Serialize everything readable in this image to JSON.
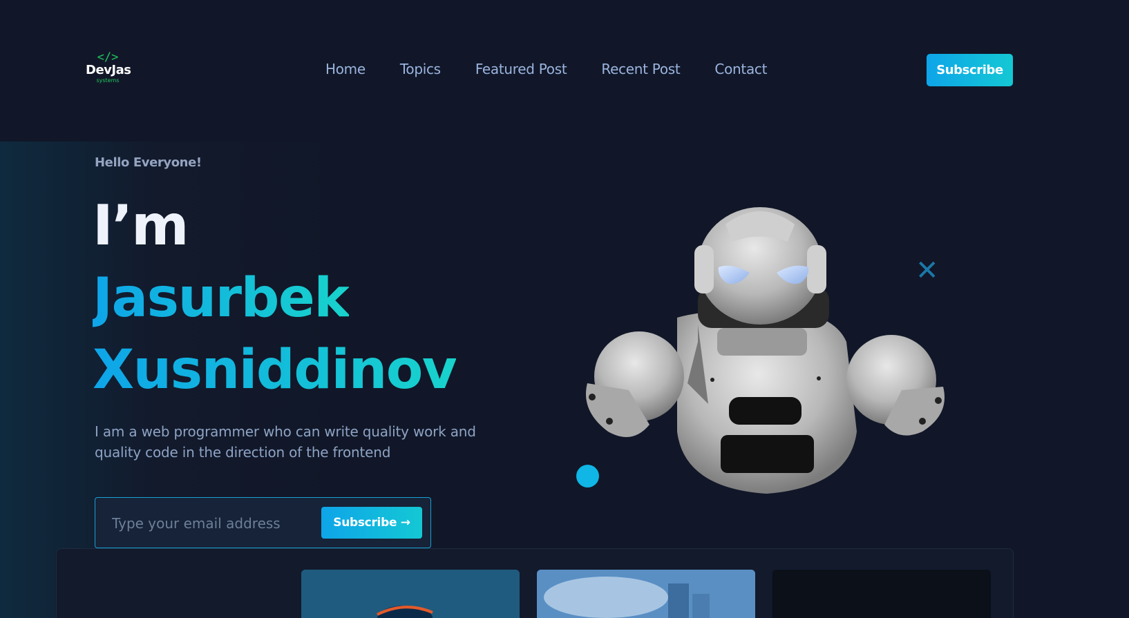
{
  "logo": {
    "icon": "</>",
    "name": "DevJas",
    "sub": "systems"
  },
  "nav": {
    "items": [
      "Home",
      "Topics",
      "Featured Post",
      "Recent Post",
      "Contact"
    ]
  },
  "header": {
    "subscribe_label": "Subscribe"
  },
  "hero": {
    "greeting": "Hello Everyone!",
    "intro": "I’m",
    "first_name": "Jasurbek",
    "last_name": "Xusniddinov",
    "description": "I am a web programmer who can write quality work and quality code in the direction of the frontend",
    "email_placeholder": "Type your email address",
    "subscribe_label": "Subscribe →"
  },
  "decor": {
    "close_mark": "✕",
    "accent_color": "#0ea5e9",
    "accent_color_2": "#14c8d4"
  },
  "cards": [
    {
      "icon": "ocean-surf-image"
    },
    {
      "icon": "city-skyline-image"
    },
    {
      "icon": "dark-image"
    }
  ]
}
